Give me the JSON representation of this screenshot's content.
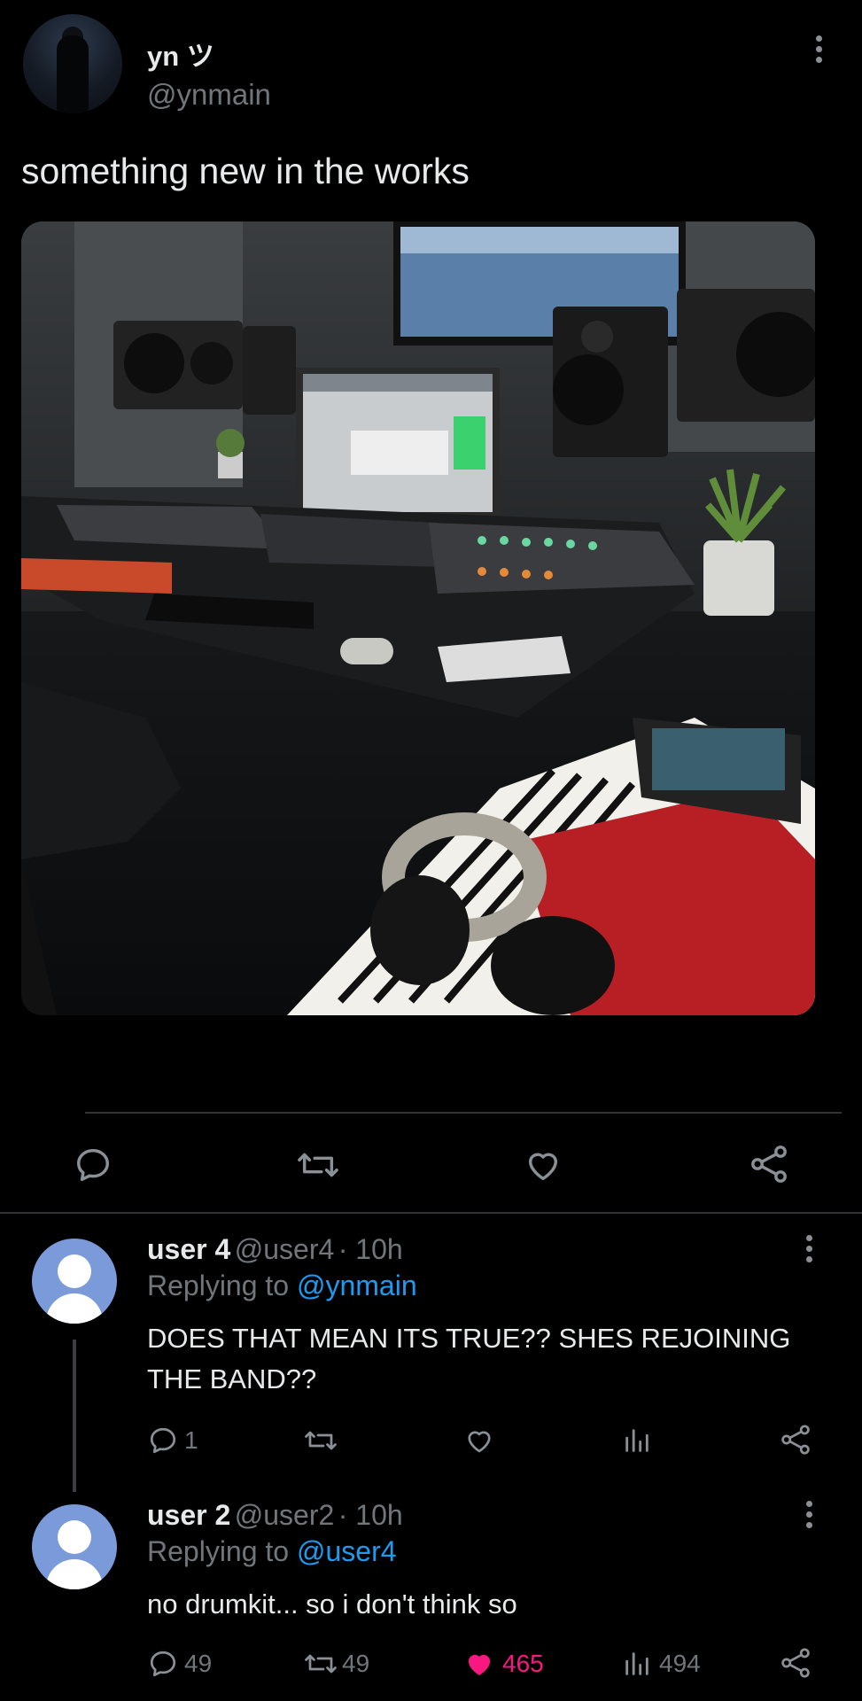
{
  "tweet": {
    "display_name": "yn ツ",
    "handle": "@ynmain",
    "text": "something new in the works"
  },
  "replies": [
    {
      "name": "user 4",
      "handle": "@user4",
      "time": "· 10h",
      "replying_prefix": "Replying to",
      "replying_to": "@ynmain",
      "text": "DOES THAT MEAN ITS TRUE?? SHES REJOINING THE BAND??",
      "reply_count": "1",
      "retweet_count": "",
      "like_count": "",
      "view_count": ""
    },
    {
      "name": "user 2",
      "handle": "@user2",
      "time": "· 10h",
      "replying_prefix": "Replying to",
      "replying_to": "@user4",
      "text": "no drumkit... so i don't think so",
      "reply_count": "49",
      "retweet_count": "49",
      "like_count": "465",
      "view_count": "494"
    }
  ],
  "colors": {
    "background": "#000000",
    "text": "#e7e9ea",
    "muted": "#71767b",
    "link": "#1d9bf0",
    "like": "#f91880"
  }
}
